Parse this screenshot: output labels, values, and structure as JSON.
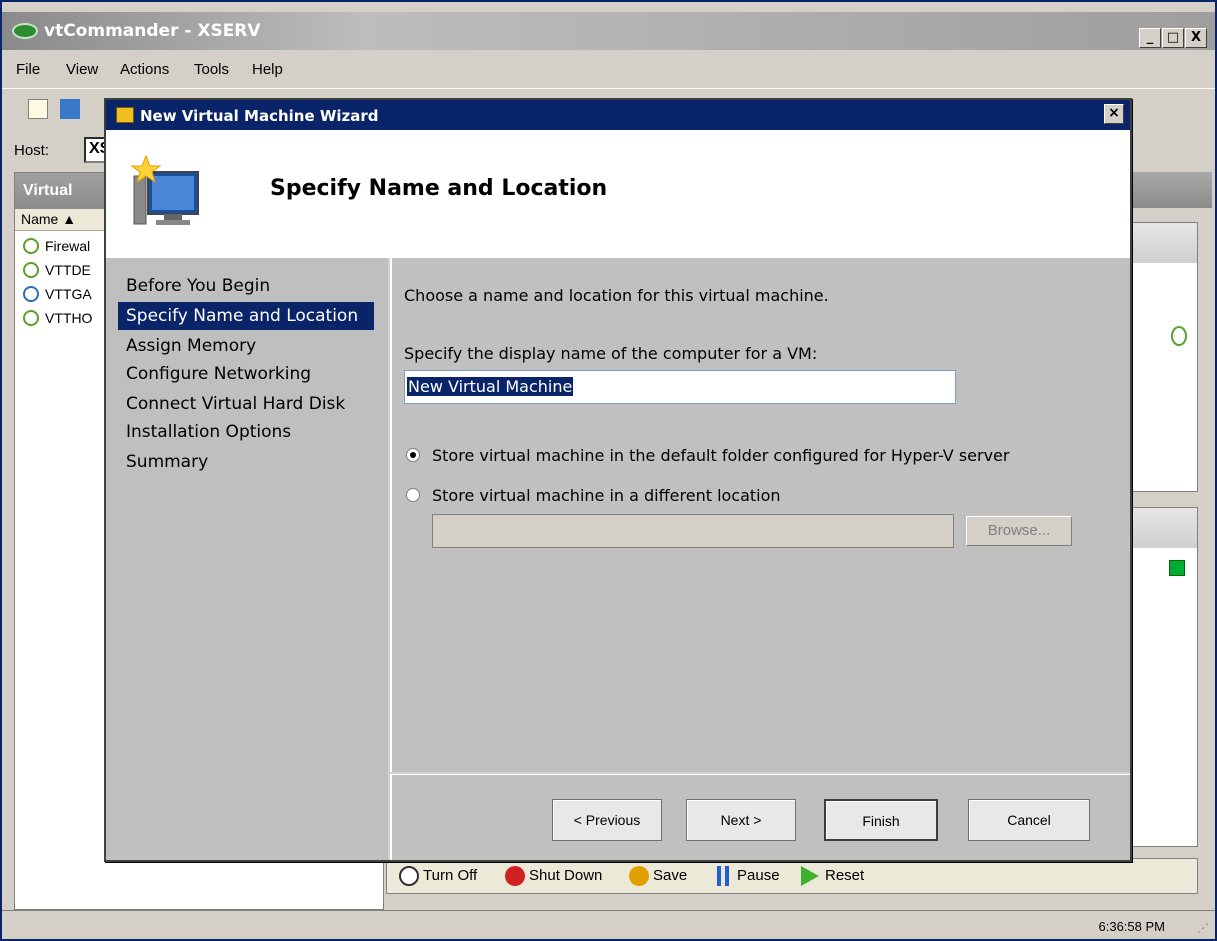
{
  "main_window": {
    "title": "vtCommander - XSERV",
    "controls": {
      "minimize": "_",
      "maximize": "□",
      "close": "X"
    },
    "menu": [
      "File",
      "View",
      "Actions",
      "Tools",
      "Help"
    ],
    "host_label": "Host:",
    "host_value": "XS",
    "vm_panel_title": "Virtual",
    "vm_column_header": "Name ▲",
    "vms": [
      {
        "name": "Firewal"
      },
      {
        "name": "VTTDE"
      },
      {
        "name": "VTTGA"
      },
      {
        "name": "VTTHO"
      }
    ],
    "actions": [
      {
        "label": "Turn Off",
        "icon": "power-off-icon",
        "color": "#303030"
      },
      {
        "label": "Shut Down",
        "icon": "shutdown-icon",
        "color": "#d02020"
      },
      {
        "label": "Save",
        "icon": "save-state-icon",
        "color": "#e0a000"
      },
      {
        "label": "Pause",
        "icon": "pause-icon",
        "color": "#2060d0"
      },
      {
        "label": "Reset",
        "icon": "reset-icon",
        "color": "#40b030"
      }
    ],
    "clock": "6:36:58 PM"
  },
  "wizard": {
    "title": "New Virtual Machine Wizard",
    "heading": "Specify Name and Location",
    "steps": [
      {
        "label": "Before You Begin",
        "active": false
      },
      {
        "label": "Specify Name and Location",
        "active": true
      },
      {
        "label": "Assign Memory",
        "active": false
      },
      {
        "label": "Configure Networking",
        "active": false
      },
      {
        "label": "Connect Virtual Hard Disk",
        "active": false
      },
      {
        "label": "Installation Options",
        "active": false
      },
      {
        "label": "Summary",
        "active": false
      }
    ],
    "intro": "Choose a name and location for this virtual machine.",
    "name_label": "Specify the display name of the computer for a VM:",
    "name_value": "New Virtual Machine",
    "radio_default": {
      "label": "Store virtual machine in the default folder configured for Hyper-V server",
      "checked": true
    },
    "radio_custom": {
      "label": "Store virtual machine in a different location",
      "checked": false
    },
    "location_value": "",
    "browse_label": "Browse...",
    "buttons": {
      "previous": "< Previous",
      "next": "Next >",
      "finish": "Finish",
      "cancel": "Cancel"
    }
  },
  "colors": {
    "title_active": "#0a246a",
    "selection": "#0a246a",
    "steps_bg": "#bfbfbf"
  }
}
